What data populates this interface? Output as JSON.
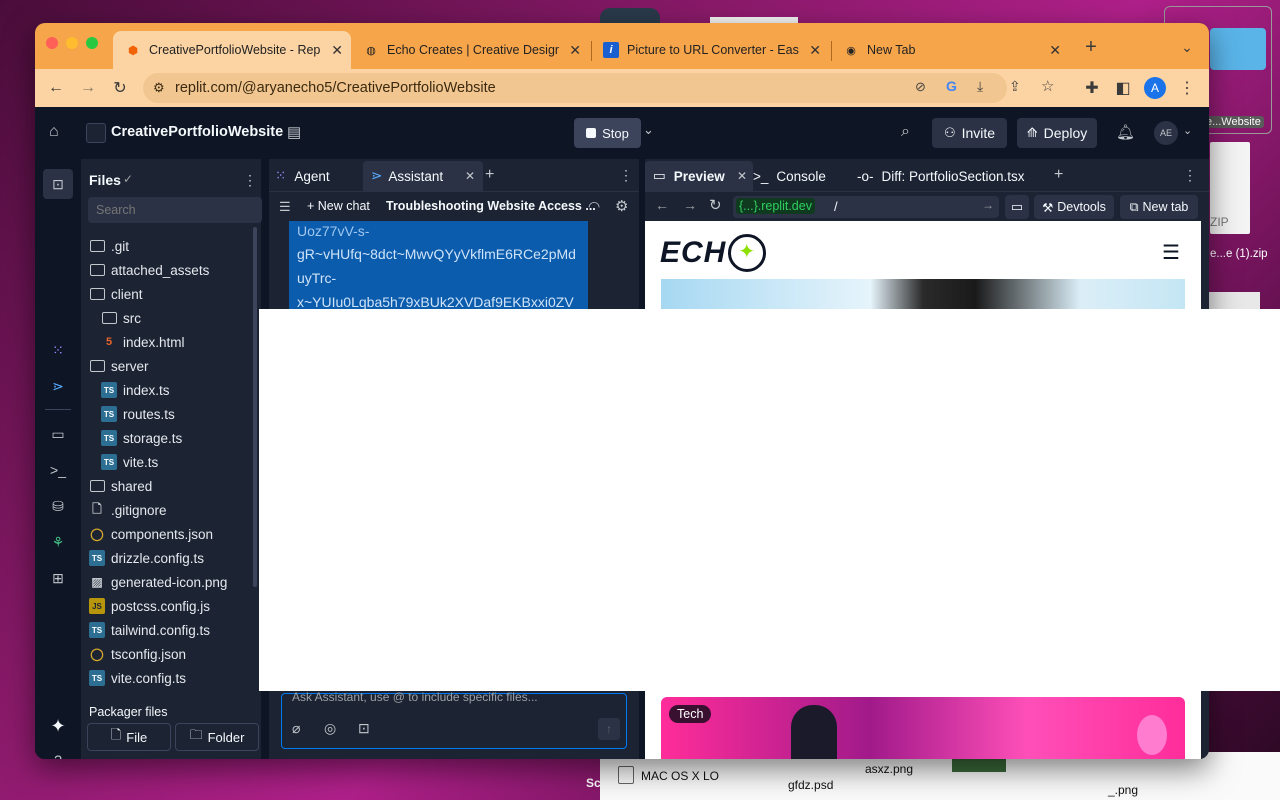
{
  "browser": {
    "tabs": [
      {
        "title": "CreativePortfolioWebsite - Rep",
        "icon": "replit-icon",
        "active": true
      },
      {
        "title": "Echo Creates | Creative Design",
        "icon": "globe-icon",
        "active": false
      },
      {
        "title": "Picture to URL Converter - Eas",
        "icon": "info-icon",
        "active": false
      },
      {
        "title": "New Tab",
        "icon": "chrome-icon",
        "active": false
      }
    ],
    "url": "replit.com/@aryanecho5/CreativePortfolioWebsite",
    "profile_initial": "A"
  },
  "replit": {
    "project_name": "CreativePortfolioWebsite",
    "stop_label": "Stop",
    "invite_label": "Invite",
    "deploy_label": "Deploy",
    "avatar_initials": "AE",
    "files_title": "Files",
    "search_placeholder": "Search",
    "file_tree": [
      {
        "name": ".git",
        "type": "folder",
        "indent": 0
      },
      {
        "name": "attached_assets",
        "type": "folder",
        "indent": 0
      },
      {
        "name": "client",
        "type": "folder",
        "indent": 0
      },
      {
        "name": "src",
        "type": "folder",
        "indent": 1
      },
      {
        "name": "index.html",
        "type": "html",
        "indent": 1
      },
      {
        "name": "server",
        "type": "folder",
        "indent": 0
      },
      {
        "name": "index.ts",
        "type": "ts",
        "indent": 1
      },
      {
        "name": "routes.ts",
        "type": "ts",
        "indent": 1
      },
      {
        "name": "storage.ts",
        "type": "ts",
        "indent": 1
      },
      {
        "name": "vite.ts",
        "type": "ts",
        "indent": 1
      },
      {
        "name": "shared",
        "type": "folder",
        "indent": 0
      },
      {
        "name": ".gitignore",
        "type": "file",
        "indent": 0
      },
      {
        "name": "components.json",
        "type": "json",
        "indent": 0
      },
      {
        "name": "drizzle.config.ts",
        "type": "ts",
        "indent": 0
      },
      {
        "name": "generated-icon.png",
        "type": "image",
        "indent": 0
      },
      {
        "name": "postcss.config.js",
        "type": "js",
        "indent": 0
      },
      {
        "name": "tailwind.config.ts",
        "type": "ts",
        "indent": 0
      },
      {
        "name": "tsconfig.json",
        "type": "json",
        "indent": 0
      },
      {
        "name": "vite.config.ts",
        "type": "ts",
        "indent": 0
      }
    ],
    "packager_files": "Packager files",
    "add_file_label": "File",
    "add_folder_label": "Folder",
    "agent_tab": "Agent",
    "assistant_tab": "Assistant",
    "new_chat_label": "New chat",
    "chat_title": "Troubleshooting Website Access ...",
    "chat_snippet_lines": [
      "Uoz77vV-s-",
      "gR~vHUfq~8dct~MwvQYyVkflmE6RCe2pMd",
      "uyTrc-",
      "x~YUIu0Lqba5h79xBUk2XVDaf9EKBxxi0ZV"
    ],
    "chat_input_placeholder": "Ask Assistant, use @ to include specific files...",
    "preview_tab": "Preview",
    "console_tab": "Console",
    "diff_tab": "Diff: PortfolioSection.tsx",
    "preview_host": "{...}.replit.dev",
    "preview_path": "/",
    "devtools_label": "Devtools",
    "new_tab_label": "New tab",
    "site_logo_text": "ECH",
    "card_badge": "Tech"
  },
  "desktop": {
    "items": [
      {
        "label": "e...Website"
      },
      {
        "label": "ZIP"
      },
      {
        "label": "e...e (1).zip"
      },
      {
        "label": "MAC OS X LO"
      },
      {
        "label": "gfdz.psd"
      },
      {
        "label": "asxz.png"
      },
      {
        "label": "_.png"
      },
      {
        "label": "Sc"
      }
    ]
  },
  "colors": {
    "tab_bar": "#f7a54a",
    "toolbar": "#fcd3a3",
    "replit_bg": "#0e1525",
    "replit_panel": "#1c2333",
    "accent_blue": "#0079f2"
  }
}
